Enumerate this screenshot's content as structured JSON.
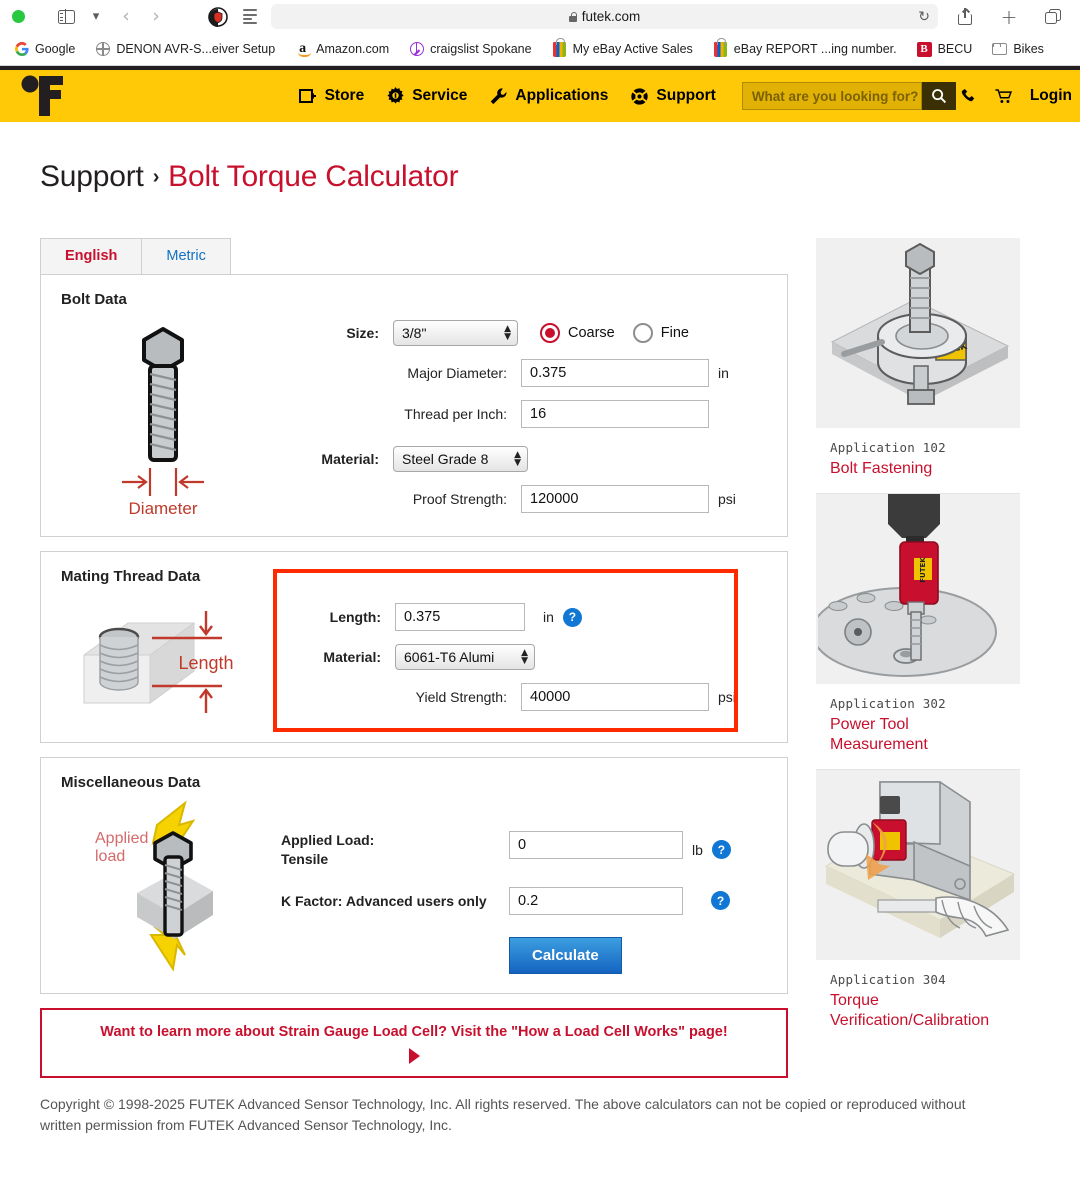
{
  "browser": {
    "url": "futek.com",
    "lock_icon": "lock-icon",
    "reload_icon": "reload-icon",
    "share_icon": "share-icon",
    "new_tab_icon": "plus-icon",
    "tab_overview_icon": "tabs-icon",
    "sidebar_icon": "sidebar-icon",
    "back_icon": "back-arrow-icon",
    "forward_icon": "forward-arrow-icon",
    "reader_icon": "reader-view-icon",
    "bookmarks": [
      {
        "label": "Google",
        "icon": "google-icon"
      },
      {
        "label": "DENON AVR-S...eiver Setup",
        "icon": "globe-icon"
      },
      {
        "label": "Amazon.com",
        "icon": "amazon-icon"
      },
      {
        "label": "craigslist Spokane",
        "icon": "peace-icon"
      },
      {
        "label": "My eBay Active Sales",
        "icon": "ebay-bag-icon"
      },
      {
        "label": "eBay REPORT ...ing number.",
        "icon": "ebay-bag-icon"
      },
      {
        "label": "BECU",
        "icon": "becu-icon"
      },
      {
        "label": "Bikes",
        "icon": "folder-icon"
      }
    ]
  },
  "site_nav": {
    "logo": "futek-logo",
    "items": [
      {
        "label": "Store",
        "icon": "store-icon"
      },
      {
        "label": "Service",
        "icon": "gear-icon"
      },
      {
        "label": "Applications",
        "icon": "wrench-icon"
      },
      {
        "label": "Support",
        "icon": "lifebuoy-icon"
      }
    ],
    "search_placeholder": "What are you looking for?",
    "search_icon": "search-icon",
    "phone_icon": "phone-icon",
    "cart_icon": "cart-icon",
    "login_label": "Login",
    "bar_color": "#FFC907"
  },
  "breadcrumb": {
    "parent": "Support",
    "separator": "›",
    "current": "Bolt Torque Calculator"
  },
  "tabs": [
    {
      "label": "English",
      "active": true
    },
    {
      "label": "Metric",
      "active": false
    }
  ],
  "bolt_data": {
    "title": "Bolt Data",
    "figure_caption": "Diameter",
    "size_label": "Size:",
    "size_value": "3/8\"",
    "thread_pitch": [
      {
        "label": "Coarse",
        "selected": true
      },
      {
        "label": "Fine",
        "selected": false
      }
    ],
    "major_diameter_label": "Major Diameter:",
    "major_diameter_value": "0.375",
    "major_diameter_unit": "in",
    "thread_per_inch_label": "Thread per Inch:",
    "thread_per_inch_value": "16",
    "material_label": "Material:",
    "material_value": "Steel Grade 8",
    "proof_strength_label": "Proof Strength:",
    "proof_strength_value": "120000",
    "proof_strength_unit": "psi"
  },
  "mating_thread_data": {
    "title": "Mating Thread Data",
    "figure_caption": "Length",
    "length_label": "Length:",
    "length_value": "0.375",
    "length_unit": "in",
    "material_label": "Material:",
    "material_value": "6061-T6 Alumi",
    "yield_strength_label": "Yield Strength:",
    "yield_strength_value": "40000",
    "yield_strength_unit": "psi",
    "help_icon": "help-icon",
    "highlight_color": "#ff2a00"
  },
  "misc_data": {
    "title": "Miscellaneous Data",
    "figure_caption": "Applied load",
    "applied_load_label_line1": "Applied Load:",
    "applied_load_label_line2": "Tensile",
    "applied_load_value": "0",
    "applied_load_unit": "lb",
    "k_factor_label": "K Factor: Advanced users only",
    "k_factor_value": "0.2",
    "calculate_label": "Calculate",
    "help_icon": "help-icon"
  },
  "promo": {
    "text": "Want to learn more about Strain Gauge Load Cell? Visit the \"How a Load Cell Works\" page!",
    "arrow_icon": "play-triangle-icon"
  },
  "applications": [
    {
      "number": "Application 102",
      "title": "Bolt Fastening",
      "image": "bolt-fastening-illustration"
    },
    {
      "number": "Application 302",
      "title": "Power Tool Measurement",
      "image": "power-tool-illustration"
    },
    {
      "number": "Application 304",
      "title": "Torque Verification/Calibration",
      "image": "torque-calibration-illustration"
    }
  ],
  "footer": {
    "text": "Copyright © 1998-2025 FUTEK Advanced Sensor Technology, Inc. All rights reserved. The above calculators can not be copied or reproduced without written permission from FUTEK Advanced Sensor Technology, Inc."
  }
}
